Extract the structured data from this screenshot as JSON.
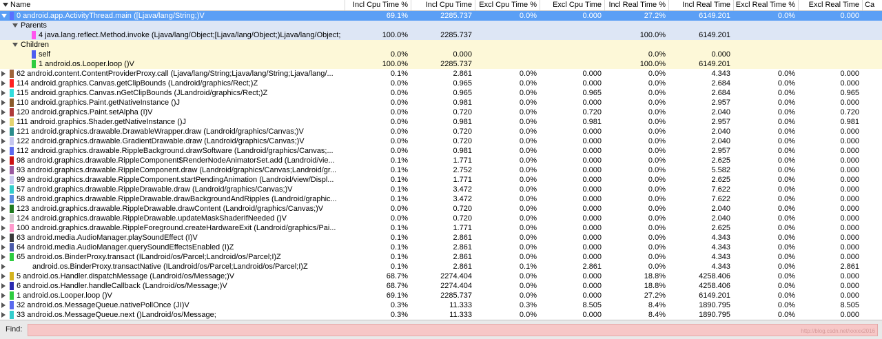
{
  "columns": [
    "Name",
    "Incl Cpu Time %",
    "Incl Cpu Time",
    "Excl Cpu Time %",
    "Excl Cpu Time",
    "Incl Real Time %",
    "Incl Real Time",
    "Excl Real Time %",
    "Excl Real Time",
    "Ca"
  ],
  "rows": [
    {
      "kind": "method",
      "selected": true,
      "expanded": true,
      "indent": 0,
      "color": "#5a70ff",
      "name": "0 android.app.ActivityThread.main ([Ljava/lang/String;)V",
      "v": [
        "69.1%",
        "2285.737",
        "0.0%",
        "0.000",
        "27.2%",
        "6149.201",
        "0.0%",
        "0.000"
      ]
    },
    {
      "kind": "group",
      "band": "parents",
      "indent": 1,
      "name": "Parents"
    },
    {
      "kind": "leaf",
      "band": "parents",
      "indent": 2,
      "color": "#ff55ee",
      "name": "4 java.lang.reflect.Method.invoke (Ljava/lang/Object;[Ljava/lang/Object;)Ljava/lang/Object;",
      "v": [
        "100.0%",
        "2285.737",
        "",
        "",
        "100.0%",
        "6149.201",
        "",
        ""
      ]
    },
    {
      "kind": "group",
      "band": "children",
      "indent": 1,
      "name": "Children"
    },
    {
      "kind": "leaf",
      "band": "children",
      "indent": 2,
      "color": "#4d5cf0",
      "name": "self",
      "v": [
        "0.0%",
        "0.000",
        "",
        "",
        "0.0%",
        "0.000",
        "",
        ""
      ]
    },
    {
      "kind": "leaf",
      "band": "children",
      "indent": 2,
      "color": "#2ecc40",
      "name": "1 android.os.Looper.loop ()V",
      "v": [
        "100.0%",
        "2285.737",
        "",
        "",
        "100.0%",
        "6149.201",
        "",
        ""
      ]
    },
    {
      "kind": "method",
      "indent": 0,
      "color": "#a0653a",
      "name": "62 android.content.ContentProviderProxy.call (Ljava/lang/String;Ljava/lang/String;Ljava/lang/...",
      "v": [
        "0.1%",
        "2.861",
        "0.0%",
        "0.000",
        "0.0%",
        "4.343",
        "0.0%",
        "0.000"
      ]
    },
    {
      "kind": "method",
      "indent": 0,
      "color": "#ff2020",
      "name": "114 android.graphics.Canvas.getClipBounds (Landroid/graphics/Rect;)Z",
      "v": [
        "0.0%",
        "0.965",
        "0.0%",
        "0.000",
        "0.0%",
        "2.684",
        "0.0%",
        "0.000"
      ]
    },
    {
      "kind": "method",
      "indent": 0,
      "color": "#33dddd",
      "name": "115 android.graphics.Canvas.nGetClipBounds (JLandroid/graphics/Rect;)Z",
      "v": [
        "0.0%",
        "0.965",
        "0.0%",
        "0.965",
        "0.0%",
        "2.684",
        "0.0%",
        "0.965"
      ]
    },
    {
      "kind": "method",
      "indent": 0,
      "color": "#8a5a2a",
      "name": "110 android.graphics.Paint.getNativeInstance ()J",
      "v": [
        "0.0%",
        "0.981",
        "0.0%",
        "0.000",
        "0.0%",
        "2.957",
        "0.0%",
        "0.000"
      ]
    },
    {
      "kind": "method",
      "indent": 0,
      "color": "#b03a3a",
      "name": "120 android.graphics.Paint.setAlpha (I)V",
      "v": [
        "0.0%",
        "0.720",
        "0.0%",
        "0.720",
        "0.0%",
        "2.040",
        "0.0%",
        "0.720"
      ]
    },
    {
      "kind": "method",
      "indent": 0,
      "color": "#e4d470",
      "name": "111 android.graphics.Shader.getNativeInstance ()J",
      "v": [
        "0.0%",
        "0.981",
        "0.0%",
        "0.981",
        "0.0%",
        "2.957",
        "0.0%",
        "0.981"
      ]
    },
    {
      "kind": "method",
      "indent": 0,
      "color": "#2a8c8c",
      "name": "121 android.graphics.drawable.DrawableWrapper.draw (Landroid/graphics/Canvas;)V",
      "v": [
        "0.0%",
        "0.720",
        "0.0%",
        "0.000",
        "0.0%",
        "2.040",
        "0.0%",
        "0.000"
      ]
    },
    {
      "kind": "method",
      "indent": 0,
      "color": "#c6c6ee",
      "name": "122 android.graphics.drawable.GradientDrawable.draw (Landroid/graphics/Canvas;)V",
      "v": [
        "0.0%",
        "0.720",
        "0.0%",
        "0.000",
        "0.0%",
        "2.040",
        "0.0%",
        "0.000"
      ]
    },
    {
      "kind": "method",
      "indent": 0,
      "color": "#5a6aee",
      "name": "112 android.graphics.drawable.RippleBackground.drawSoftware (Landroid/graphics/Canvas;...",
      "v": [
        "0.0%",
        "0.981",
        "0.0%",
        "0.000",
        "0.0%",
        "2.957",
        "0.0%",
        "0.000"
      ]
    },
    {
      "kind": "method",
      "indent": 0,
      "color": "#cc1111",
      "name": "98 android.graphics.drawable.RippleComponent$RenderNodeAnimatorSet.add (Landroid/vie...",
      "v": [
        "0.1%",
        "1.771",
        "0.0%",
        "0.000",
        "0.0%",
        "2.625",
        "0.0%",
        "0.000"
      ]
    },
    {
      "kind": "method",
      "indent": 0,
      "color": "#9a5aa0",
      "name": "93 android.graphics.drawable.RippleComponent.draw (Landroid/graphics/Canvas;Landroid/gr...",
      "v": [
        "0.1%",
        "2.752",
        "0.0%",
        "0.000",
        "0.0%",
        "5.582",
        "0.0%",
        "0.000"
      ]
    },
    {
      "kind": "method",
      "indent": 0,
      "color": "#c9c9f0",
      "name": "99 android.graphics.drawable.RippleComponent.startPendingAnimation (Landroid/view/Displ...",
      "v": [
        "0.1%",
        "1.771",
        "0.0%",
        "0.000",
        "0.0%",
        "2.625",
        "0.0%",
        "0.000"
      ]
    },
    {
      "kind": "method",
      "indent": 0,
      "color": "#33cccc",
      "name": "57 android.graphics.drawable.RippleDrawable.draw (Landroid/graphics/Canvas;)V",
      "v": [
        "0.1%",
        "3.472",
        "0.0%",
        "0.000",
        "0.0%",
        "7.622",
        "0.0%",
        "0.000"
      ]
    },
    {
      "kind": "method",
      "indent": 0,
      "color": "#5a8ae0",
      "name": "58 android.graphics.drawable.RippleDrawable.drawBackgroundAndRipples (Landroid/graphic...",
      "v": [
        "0.1%",
        "3.472",
        "0.0%",
        "0.000",
        "0.0%",
        "7.622",
        "0.0%",
        "0.000"
      ]
    },
    {
      "kind": "method",
      "indent": 0,
      "color": "#1f7a1f",
      "name": "123 android.graphics.drawable.RippleDrawable.drawContent (Landroid/graphics/Canvas;)V",
      "v": [
        "0.0%",
        "0.720",
        "0.0%",
        "0.000",
        "0.0%",
        "2.040",
        "0.0%",
        "0.000"
      ]
    },
    {
      "kind": "method",
      "indent": 0,
      "color": "#cccccc",
      "name": "124 android.graphics.drawable.RippleDrawable.updateMaskShaderIfNeeded ()V",
      "v": [
        "0.0%",
        "0.720",
        "0.0%",
        "0.000",
        "0.0%",
        "2.040",
        "0.0%",
        "0.000"
      ]
    },
    {
      "kind": "method",
      "indent": 0,
      "color": "#ff99cc",
      "name": "100 android.graphics.drawable.RippleForeground.createHardwareExit (Landroid/graphics/Pai...",
      "v": [
        "0.1%",
        "1.771",
        "0.0%",
        "0.000",
        "0.0%",
        "2.625",
        "0.0%",
        "0.000"
      ]
    },
    {
      "kind": "method",
      "indent": 0,
      "color": "#3a3a3a",
      "name": "63 android.media.AudioManager.playSoundEffect (I)V",
      "v": [
        "0.1%",
        "2.861",
        "0.0%",
        "0.000",
        "0.0%",
        "4.343",
        "0.0%",
        "0.000"
      ]
    },
    {
      "kind": "method",
      "indent": 0,
      "color": "#4a5aaa",
      "name": "64 android.media.AudioManager.querySoundEffectsEnabled (I)Z",
      "v": [
        "0.1%",
        "2.861",
        "0.0%",
        "0.000",
        "0.0%",
        "4.343",
        "0.0%",
        "0.000"
      ]
    },
    {
      "kind": "method",
      "indent": 0,
      "color": "#2ecc40",
      "name": "65 android.os.BinderProxy.transact (ILandroid/os/Parcel;Landroid/os/Parcel;I)Z",
      "v": [
        "0.1%",
        "2.861",
        "0.0%",
        "0.000",
        "0.0%",
        "4.343",
        "0.0%",
        "0.000"
      ]
    },
    {
      "kind": "method",
      "indent": 0,
      "color": "",
      "name": "android.os.BinderProxy.transactNative (ILandroid/os/Parcel;Landroid/os/Parcel;I)Z",
      "v": [
        "0.1%",
        "2.861",
        "0.1%",
        "2.861",
        "0.0%",
        "4.343",
        "0.0%",
        "2.861"
      ]
    },
    {
      "kind": "method",
      "indent": 0,
      "color": "#d4b420",
      "name": "5 android.os.Handler.dispatchMessage (Landroid/os/Message;)V",
      "v": [
        "68.7%",
        "2274.404",
        "0.0%",
        "0.000",
        "18.8%",
        "4258.406",
        "0.0%",
        "0.000"
      ]
    },
    {
      "kind": "method",
      "indent": 0,
      "color": "#2a2ab0",
      "name": "6 android.os.Handler.handleCallback (Landroid/os/Message;)V",
      "v": [
        "68.7%",
        "2274.404",
        "0.0%",
        "0.000",
        "18.8%",
        "4258.406",
        "0.0%",
        "0.000"
      ]
    },
    {
      "kind": "method",
      "indent": 0,
      "color": "#2ecc40",
      "name": "1 android.os.Looper.loop ()V",
      "v": [
        "69.1%",
        "2285.737",
        "0.0%",
        "0.000",
        "27.2%",
        "6149.201",
        "0.0%",
        "0.000"
      ]
    },
    {
      "kind": "method",
      "indent": 0,
      "color": "#5a6aee",
      "name": "32 android.os.MessageQueue.nativePollOnce (JI)V",
      "v": [
        "0.3%",
        "11.333",
        "0.3%",
        "8.505",
        "8.4%",
        "1890.795",
        "0.0%",
        "8.505"
      ]
    },
    {
      "kind": "method",
      "indent": 0,
      "color": "#33cccc",
      "name": "33 android.os.MessageQueue.next ()Landroid/os/Message;",
      "v": [
        "0.3%",
        "11.333",
        "0.0%",
        "0.000",
        "8.4%",
        "1890.795",
        "0.0%",
        "0.000"
      ]
    }
  ],
  "find": {
    "label": "Find:",
    "value": "",
    "watermark": "http://blog.csdn.net/xxxxx2016"
  }
}
